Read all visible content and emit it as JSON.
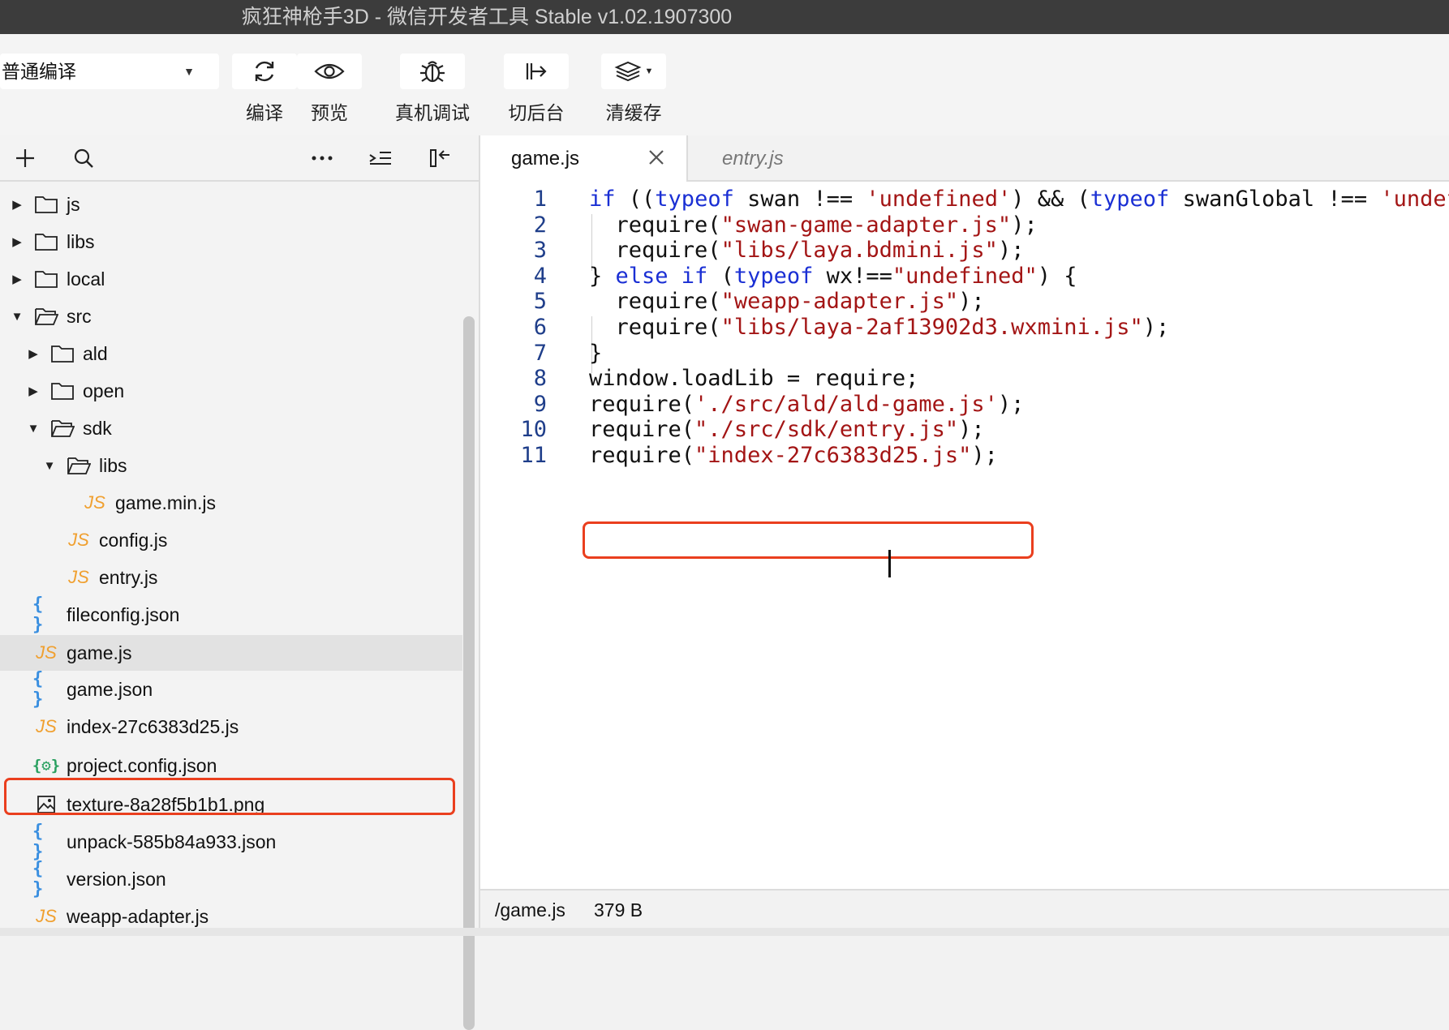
{
  "window": {
    "title": "疯狂神枪手3D - 微信开发者工具 Stable v1.02.1907300"
  },
  "toolbar": {
    "mode_select": "普通编译",
    "buttons": [
      {
        "label": "编译",
        "icon": "refresh-icon"
      },
      {
        "label": "预览",
        "icon": "eye-icon"
      },
      {
        "label": "真机调试",
        "icon": "bug-icon"
      },
      {
        "label": "切后台",
        "icon": "switch-background-icon"
      },
      {
        "label": "清缓存",
        "icon": "layers-icon"
      }
    ]
  },
  "sidebar": {
    "tools": [
      "plus-icon",
      "search-icon",
      "more-icon",
      "indent-icon",
      "collapse-panel-icon"
    ],
    "tree": [
      {
        "label": "js",
        "type": "folder",
        "expanded": false
      },
      {
        "label": "libs",
        "type": "folder",
        "expanded": false
      },
      {
        "label": "local",
        "type": "folder",
        "expanded": false
      },
      {
        "label": "src",
        "type": "folder",
        "expanded": true
      },
      {
        "label": "ald",
        "type": "folder",
        "expanded": false
      },
      {
        "label": "open",
        "type": "folder",
        "expanded": false
      },
      {
        "label": "sdk",
        "type": "folder",
        "expanded": true
      },
      {
        "label": "libs",
        "type": "folder",
        "expanded": true
      },
      {
        "label": "game.min.js",
        "type": "js"
      },
      {
        "label": "config.js",
        "type": "js"
      },
      {
        "label": "entry.js",
        "type": "js"
      },
      {
        "label": "fileconfig.json",
        "type": "json"
      },
      {
        "label": "game.js",
        "type": "js",
        "selected": true
      },
      {
        "label": "game.json",
        "type": "json"
      },
      {
        "label": "index-27c6383d25.js",
        "type": "js"
      },
      {
        "label": "project.config.json",
        "type": "config"
      },
      {
        "label": "texture-8a28f5b1b1.png",
        "type": "image"
      },
      {
        "label": "unpack-585b84a933.json",
        "type": "json"
      },
      {
        "label": "version.json",
        "type": "json"
      },
      {
        "label": "weapp-adapter.js",
        "type": "js"
      }
    ]
  },
  "editor": {
    "tabs": [
      {
        "label": "game.js",
        "active": true
      },
      {
        "label": "entry.js",
        "active": false
      }
    ],
    "lines": [
      {
        "n": "1",
        "tokens": [
          [
            "kw",
            "if"
          ],
          [
            "p",
            " (("
          ],
          [
            "kw",
            "typeof"
          ],
          [
            "p",
            " swan !== "
          ],
          [
            "str",
            "'undefined'"
          ],
          [
            "p",
            ") && ("
          ],
          [
            "kw",
            "typeof"
          ],
          [
            "p",
            " swanGlobal !== "
          ],
          [
            "str",
            "'undefined'"
          ],
          [
            "p",
            ")) {"
          ]
        ]
      },
      {
        "n": "2",
        "tokens": [
          [
            "p",
            "  require("
          ],
          [
            "str",
            "\"swan-game-adapter.js\""
          ],
          [
            "p",
            ");"
          ]
        ]
      },
      {
        "n": "3",
        "tokens": [
          [
            "p",
            "  require("
          ],
          [
            "str",
            "\"libs/laya.bdmini.js\""
          ],
          [
            "p",
            ");"
          ]
        ]
      },
      {
        "n": "4",
        "tokens": [
          [
            "p",
            "} "
          ],
          [
            "kw",
            "else if"
          ],
          [
            "p",
            " ("
          ],
          [
            "kw",
            "typeof"
          ],
          [
            "p",
            " wx!=="
          ],
          [
            "str",
            "\"undefined\""
          ],
          [
            "p",
            ") {"
          ]
        ]
      },
      {
        "n": "5",
        "tokens": [
          [
            "p",
            "  require("
          ],
          [
            "str",
            "\"weapp-adapter.js\""
          ],
          [
            "p",
            ");"
          ]
        ]
      },
      {
        "n": "6",
        "tokens": [
          [
            "p",
            "  require("
          ],
          [
            "str",
            "\"libs/laya-2af13902d3.wxmini.js\""
          ],
          [
            "p",
            ");"
          ]
        ]
      },
      {
        "n": "7",
        "tokens": [
          [
            "p",
            "}"
          ]
        ]
      },
      {
        "n": "8",
        "tokens": [
          [
            "p",
            "window.loadLib = require;"
          ]
        ]
      },
      {
        "n": "9",
        "tokens": [
          [
            "p",
            "require("
          ],
          [
            "str",
            "'./src/ald/ald-game.js'"
          ],
          [
            "p",
            ");"
          ]
        ]
      },
      {
        "n": "10",
        "tokens": [
          [
            "p",
            "require("
          ],
          [
            "str",
            "\"./src/sdk/entry.js\""
          ],
          [
            "p",
            ");"
          ]
        ]
      },
      {
        "n": "11",
        "tokens": [
          [
            "p",
            "require("
          ],
          [
            "str",
            "\"index-27c6383d25.js\""
          ],
          [
            "p",
            ");"
          ]
        ]
      }
    ]
  },
  "status": {
    "path": "/game.js",
    "size": "379 B"
  },
  "colors": {
    "highlight": "#ea3f1e",
    "keyword": "#1a2fd4",
    "string": "#a31515",
    "js_icon": "#f0a030",
    "json_icon": "#3a8fe0"
  }
}
